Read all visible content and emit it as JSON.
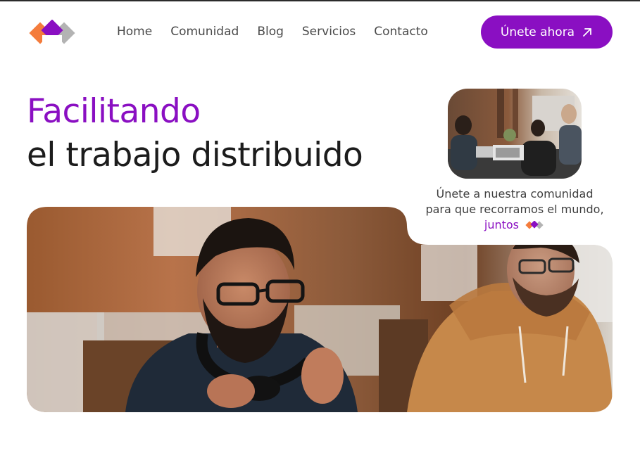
{
  "header": {
    "logo_name": "brand-logo",
    "nav": [
      {
        "label": "Home"
      },
      {
        "label": "Comunidad"
      },
      {
        "label": "Blog"
      },
      {
        "label": "Servicios"
      },
      {
        "label": "Contacto"
      }
    ],
    "cta_label": "Únete ahora",
    "cta_icon": "arrow-up-right-icon"
  },
  "hero": {
    "title_accent": "Facilitando",
    "title_main": "el trabajo distribuido",
    "community_line1": "Únete a nuestra comunidad",
    "community_line2": "para que recorramos el mundo,",
    "community_together": "juntos"
  },
  "colors": {
    "accent": "#8a0fc2",
    "logo_orange": "#f47c3c",
    "logo_purple": "#8a0fc2",
    "logo_gray": "#b3b3b3",
    "text_dark": "#1c1c1c"
  }
}
